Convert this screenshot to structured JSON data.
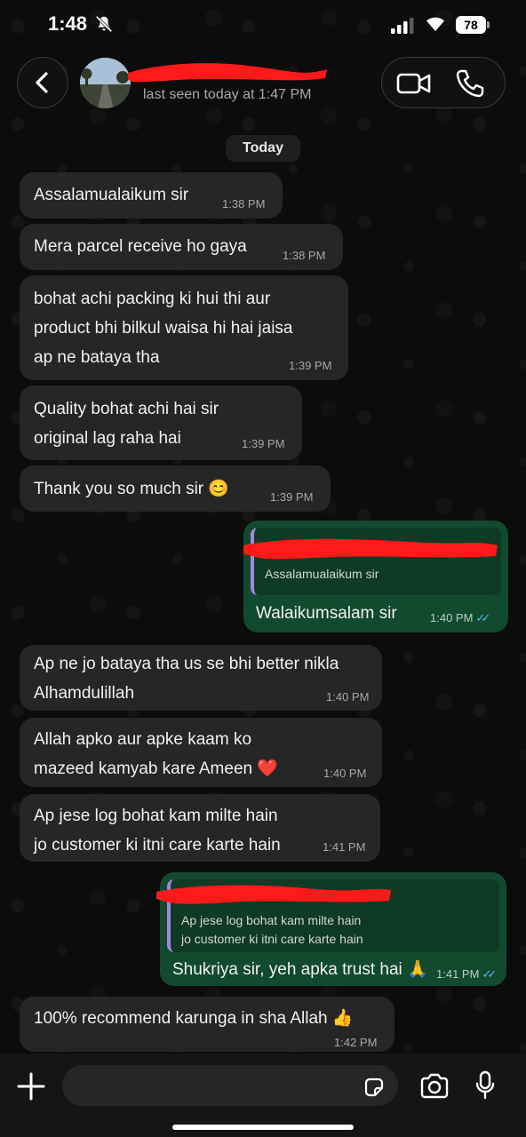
{
  "status_bar": {
    "time": "1:48",
    "battery": "78"
  },
  "header": {
    "last_seen": "last seen today at 1:47 PM"
  },
  "date_label": "Today",
  "messages": [
    {
      "text": "Assalamualaikum sir",
      "time": "1:38 PM"
    },
    {
      "text": "Mera parcel receive ho gaya",
      "time": "1:38 PM"
    },
    {
      "text": "bohat achi packing ki hui thi aur\nproduct bhi bilkul waisa hi hai jaisa\nap ne bataya tha",
      "time": "1:39 PM"
    },
    {
      "text": "Quality bohat achi hai sir\noriginal lag raha hai",
      "time": "1:39 PM"
    },
    {
      "text": "Thank you so much sir 😊",
      "time": "1:39 PM"
    },
    {
      "quote": "Assalamualaikum sir",
      "text": "Walaikumsalam sir",
      "time": "1:40 PM"
    },
    {
      "text": "Ap ne jo bataya tha us se bhi better nikla\nAlhamdulillah",
      "time": "1:40 PM"
    },
    {
      "text": "Allah apko aur apke kaam ko\nmazeed kamyab kare Ameen ❤️",
      "time": "1:40 PM"
    },
    {
      "text": "Ap jese log bohat kam milte hain\njo customer ki itni care karte hain",
      "time": "1:41 PM"
    },
    {
      "quote": "Ap jese log bohat kam milte hain\njo customer ki itni care karte hain",
      "text": "Shukriya sir, yeh apka trust hai 🙏",
      "time": "1:41 PM"
    },
    {
      "text": "100% recommend karunga in sha Allah 👍",
      "time": "1:42 PM"
    }
  ],
  "colors": {
    "incoming_bubble": "#262626",
    "outgoing_bubble": "#124a2f",
    "read_ticks": "#4fb6ec",
    "redaction": "#ff1a1a"
  },
  "icons": [
    "bell-off-icon",
    "signal-icon",
    "wifi-icon",
    "back-chevron-icon",
    "video-call-icon",
    "phone-icon",
    "plus-icon",
    "sticker-icon",
    "camera-icon",
    "mic-icon",
    "double-check-icon"
  ]
}
